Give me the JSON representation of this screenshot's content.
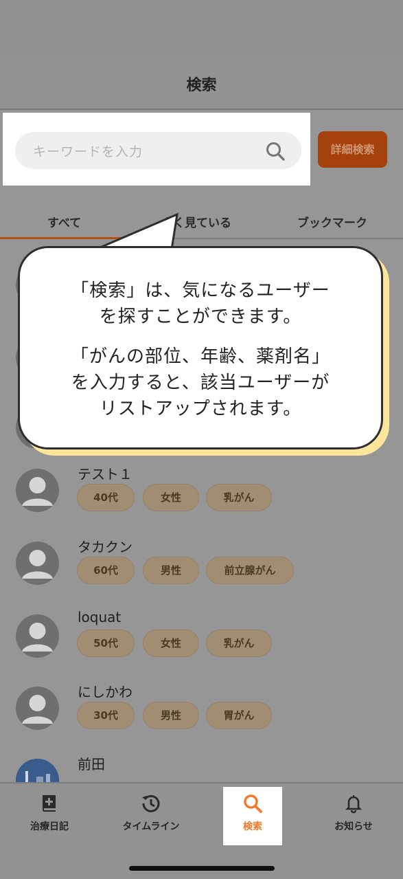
{
  "header": {
    "title": "検索"
  },
  "search": {
    "placeholder": "キーワードを入力",
    "detail_button_label": "詳細検索"
  },
  "tabs": [
    {
      "label": "すべて",
      "active": true
    },
    {
      "label": "よく見ている",
      "active": false
    },
    {
      "label": "ブックマーク",
      "active": false
    }
  ],
  "tip": {
    "paragraph1_line1": "「検索」は、気になるユーザー",
    "paragraph1_line2": "を探すことができます。",
    "paragraph2_line1": "「がんの部位、年齢、薬剤名」",
    "paragraph2_line2": "を入力すると、該当ユーザーが",
    "paragraph2_line3": "リストアップされます。"
  },
  "users": [
    {
      "name": "テスト１",
      "tags": [
        "40代",
        "女性",
        "乳がん"
      ]
    },
    {
      "name": "タカクン",
      "tags": [
        "60代",
        "男性",
        "前立腺がん"
      ]
    },
    {
      "name": "loquat",
      "tags": [
        "50代",
        "女性",
        "乳がん"
      ]
    },
    {
      "name": "にしかわ",
      "tags": [
        "30代",
        "男性",
        "胃がん"
      ]
    },
    {
      "name": "前田",
      "tags": []
    }
  ],
  "bottom_nav": [
    {
      "label": "治療日記",
      "icon": "book-plus-icon"
    },
    {
      "label": "タイムライン",
      "icon": "history-icon"
    },
    {
      "label": "検索",
      "icon": "search-icon",
      "active": true
    },
    {
      "label": "お知らせ",
      "icon": "bell-icon"
    }
  ],
  "colors": {
    "accent": "#f07a2a",
    "overlay_gray": "#969696",
    "tip_shadow": "#fde69c",
    "detail_button": "#a4410c",
    "tag_bg": "#a18e72"
  }
}
